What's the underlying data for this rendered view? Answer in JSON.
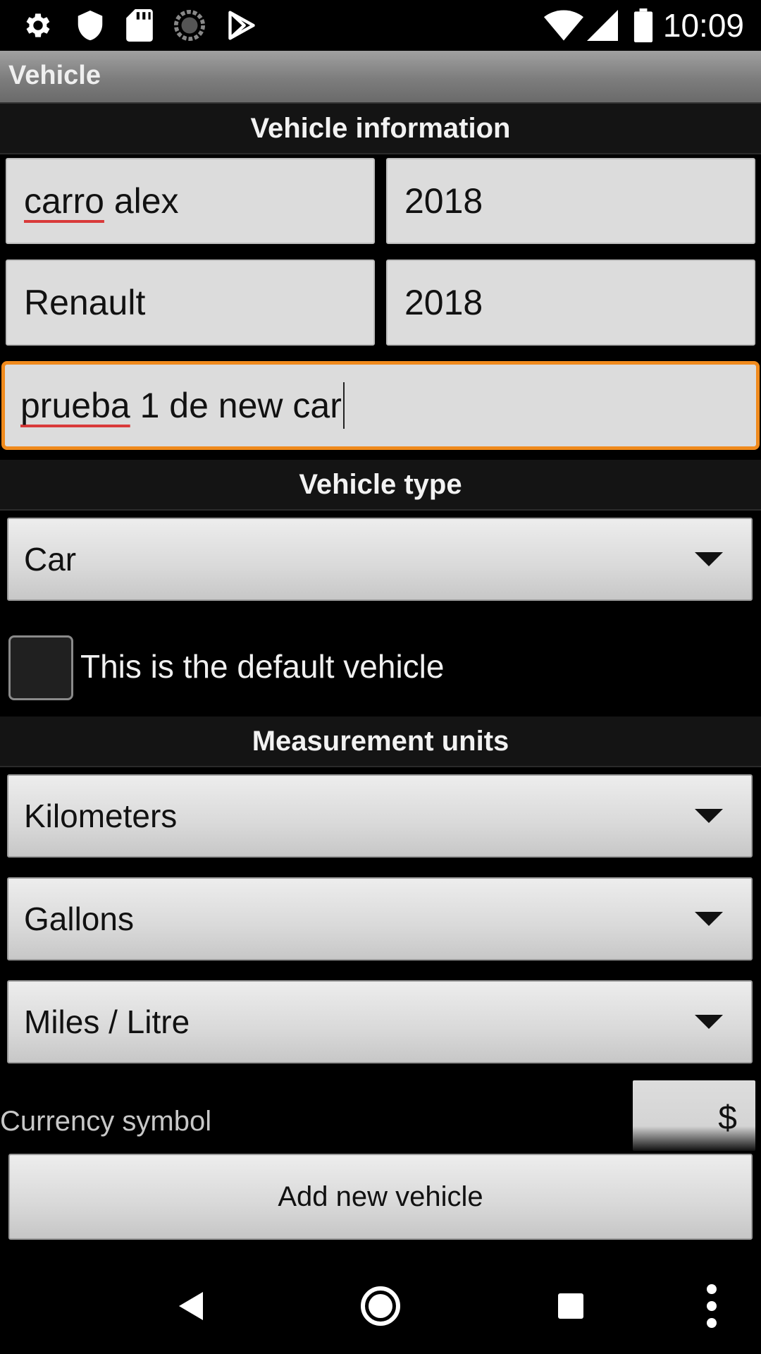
{
  "status_bar": {
    "time": "10:09",
    "left_icons": [
      "gear-icon",
      "shield-icon",
      "sd-card-icon",
      "sync-circle-icon",
      "play-store-icon"
    ],
    "right_icons": [
      "wifi-icon",
      "signal-icon",
      "battery-icon"
    ]
  },
  "action_bar": {
    "title": "Vehicle"
  },
  "vehicle_info": {
    "header": "Vehicle information",
    "name_word1": "carro",
    "name_word2": " alex",
    "year_field_1": "2018",
    "make": "Renault",
    "year_field_2": "2018",
    "desc_word1": "prueba",
    "desc_rest": " 1 de new car"
  },
  "vehicle_type": {
    "header": "Vehicle type",
    "selected": "Car"
  },
  "default_vehicle": {
    "label": "This is the default vehicle",
    "checked": false
  },
  "measurement_units": {
    "header": "Measurement units",
    "distance": "Kilometers",
    "volume": "Gallons",
    "consumption": "Miles / Litre"
  },
  "currency": {
    "label": "Currency symbol",
    "value": "$"
  },
  "add_button": {
    "label": "Add new vehicle"
  },
  "nav_bar": {
    "buttons": [
      "back-icon",
      "home-icon",
      "recents-icon",
      "overflow-menu-icon"
    ]
  },
  "colors": {
    "focus_accent": "#f08a1c",
    "spellcheck_underline": "#d93a3a",
    "background": "#000000",
    "field_background": "#dcdcdc"
  }
}
